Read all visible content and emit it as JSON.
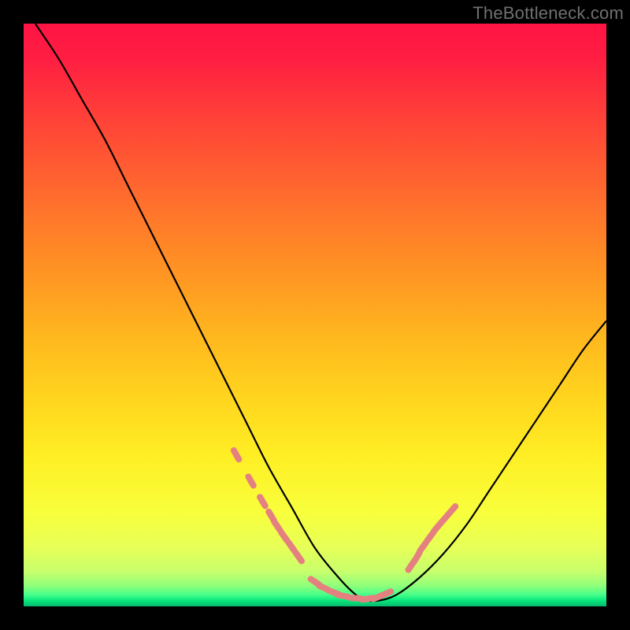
{
  "watermark": "TheBottleneck.com",
  "chart_data": {
    "type": "line",
    "title": "",
    "xlabel": "",
    "ylabel": "",
    "xlim": [
      0,
      100
    ],
    "ylim": [
      0,
      100
    ],
    "grid": false,
    "legend": false,
    "series": [
      {
        "name": "bottleneck-curve",
        "x": [
          2,
          6,
          10,
          14,
          18,
          22,
          26,
          30,
          34,
          38,
          42,
          46,
          50,
          54,
          57,
          59,
          61,
          64,
          68,
          72,
          76,
          80,
          84,
          88,
          92,
          96,
          100
        ],
        "y": [
          100,
          94,
          87,
          80,
          72,
          64,
          56,
          48,
          40,
          32,
          24,
          17,
          10,
          5,
          2,
          1,
          1,
          2,
          5,
          9,
          14,
          20,
          26,
          32,
          38,
          44,
          49
        ]
      }
    ],
    "highlight_segments": [
      {
        "name": "scattered-markers-left",
        "x": [
          36.5,
          39,
          41,
          42.5,
          43.5,
          44.7,
          46,
          47.2
        ],
        "y": [
          26,
          21.5,
          18,
          15.5,
          13.8,
          12,
          10.2,
          8.5
        ]
      },
      {
        "name": "scattered-markers-bottom",
        "x": [
          50,
          51.5,
          53.2,
          54.8,
          57,
          59,
          60.8,
          62.2
        ],
        "y": [
          4.2,
          3.2,
          2.4,
          1.8,
          1.4,
          1.3,
          1.6,
          2.2
        ]
      },
      {
        "name": "scattered-markers-right",
        "x": [
          66.5,
          67.5,
          68.5,
          69.8,
          71,
          72.2,
          73.5
        ],
        "y": [
          7,
          8.5,
          10.2,
          12,
          13.6,
          15,
          16.5
        ]
      }
    ],
    "background_gradient": {
      "top": "#ff1444",
      "mid": "#ffee24",
      "bottom": "#06b86e"
    },
    "curve_color": "#000000",
    "marker_color": "#e58080"
  }
}
